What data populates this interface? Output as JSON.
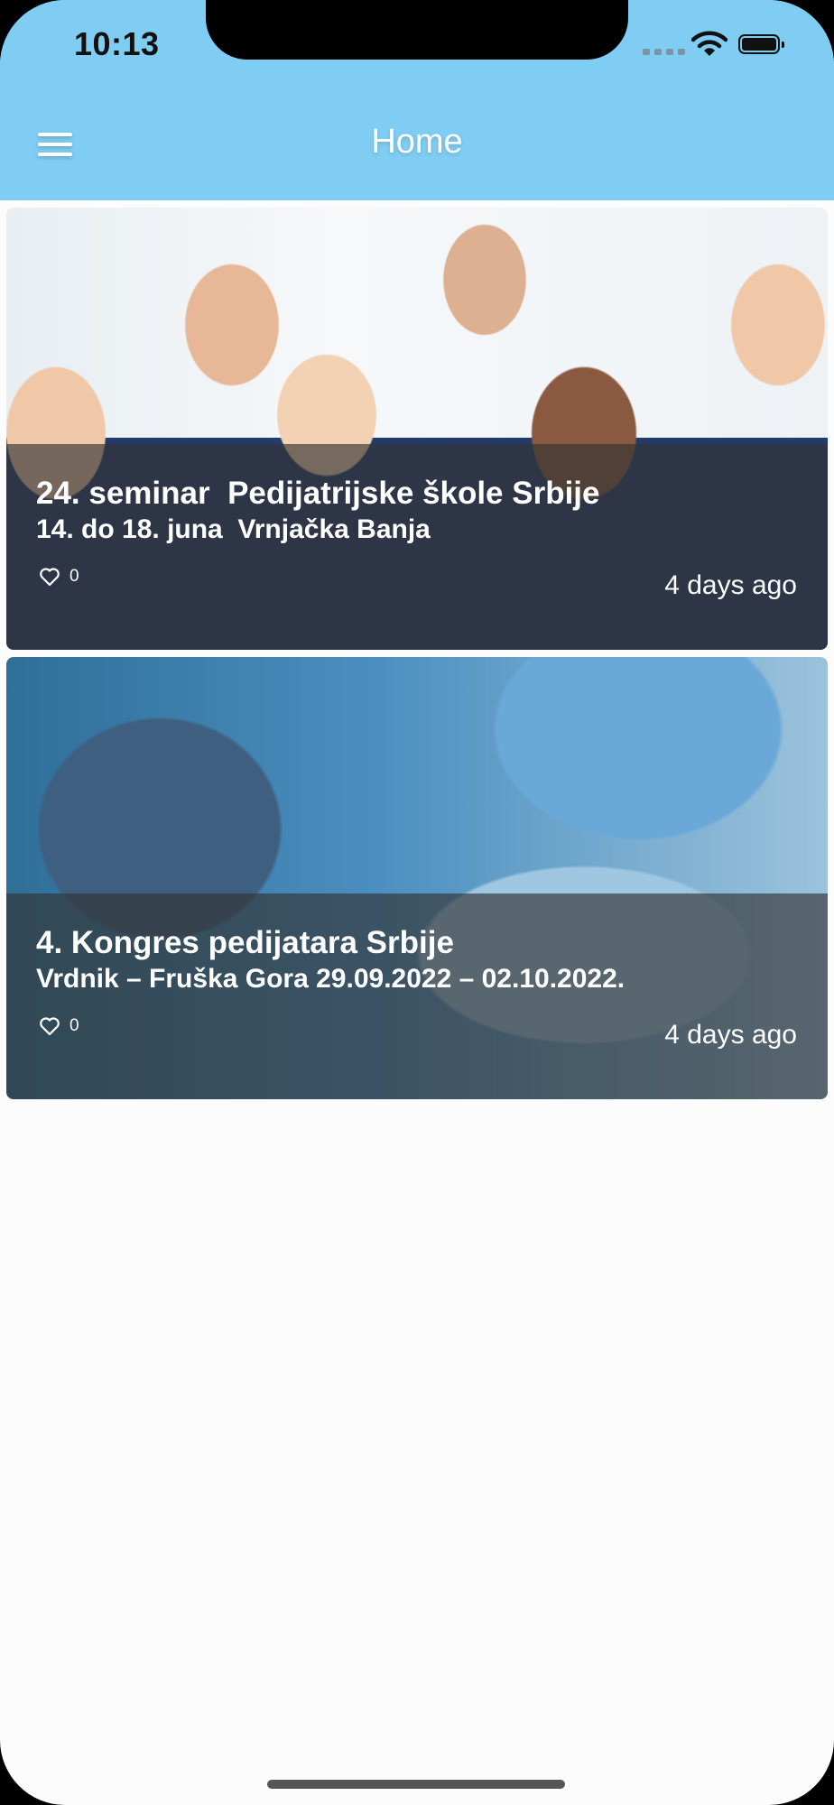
{
  "status_bar": {
    "time": "10:13"
  },
  "header": {
    "title": "Home",
    "menu_icon": "hamburger-menu-icon"
  },
  "posts": [
    {
      "title": "24. seminar  Pedijatrijske škole Srbije",
      "subtitle": "14. do 18. juna  Vrnjačka Banja",
      "likes": "0",
      "time": "4 days ago"
    },
    {
      "title": "4. Kongres pedijatara Srbije",
      "subtitle": "Vrdnik – Fruška Gora 29.09.2022 – 02.10.2022.",
      "likes": "0",
      "time": "4 days ago"
    }
  ],
  "colors": {
    "header_bg": "#7fcdf2",
    "overlay": "#323232",
    "page_bg": "#fcfcfc"
  }
}
